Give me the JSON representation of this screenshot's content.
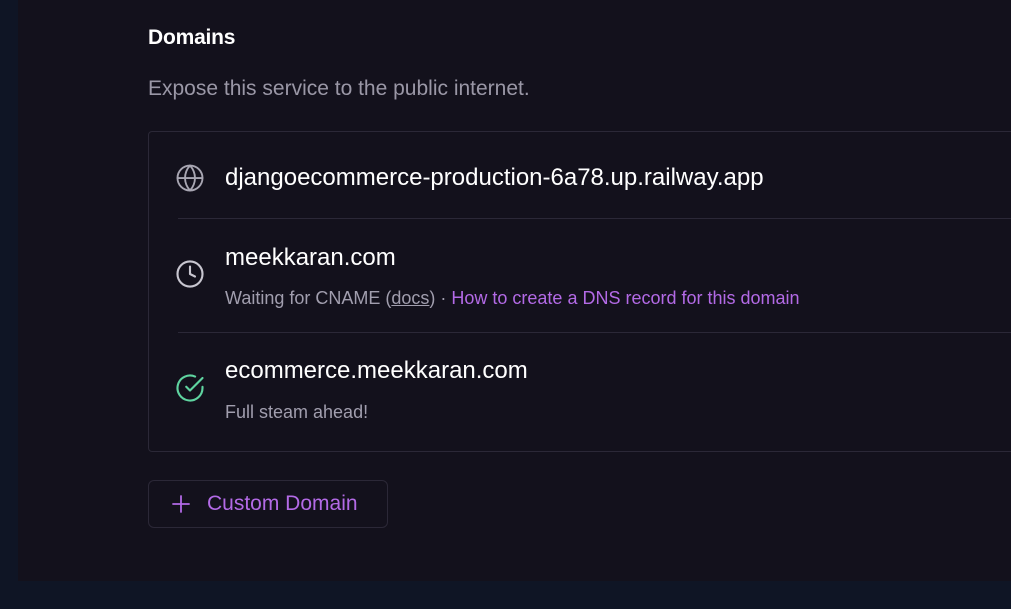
{
  "section": {
    "title": "Domains",
    "description": "Expose this service to the public internet."
  },
  "domains": [
    {
      "hostname": "djangoecommerce-production-6a78.up.railway.app",
      "icon": "globe-icon"
    },
    {
      "hostname": "meekkaran.com",
      "icon": "clock-icon",
      "status_prefix": "Waiting for CNAME (",
      "docs_link": "docs",
      "status_middle": ") · ",
      "help_link": "How to create a DNS record for this domain"
    },
    {
      "hostname": "ecommerce.meekkaran.com",
      "icon": "check-circle-icon",
      "status": "Full steam ahead!"
    }
  ],
  "add_button": {
    "label": "Custom Domain"
  },
  "colors": {
    "accent": "#b36ae6",
    "success": "#5fd4a0",
    "background": "#13111c",
    "outer_background": "#0f1525"
  }
}
